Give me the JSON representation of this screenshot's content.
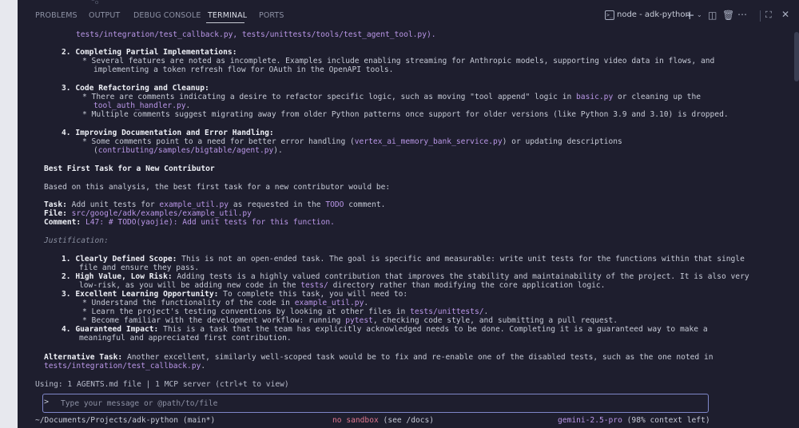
{
  "panel": {
    "tabs": [
      {
        "label": "PROBLEMS"
      },
      {
        "label": "OUTPUT"
      },
      {
        "label": "DEBUG CONSOLE"
      },
      {
        "label": "TERMINAL",
        "active": true
      },
      {
        "label": "PORTS"
      }
    ],
    "terminal_name": "node - adk-python",
    "icons": [
      "terminal-icon",
      "plus-icon",
      "chevron-down-icon",
      "split-icon",
      "trash-icon",
      "more-icon",
      "maximize-icon",
      "close-icon"
    ]
  },
  "output": {
    "l1": "tests/integration/test_callback.py, tests/unittests/tools/test_agent_tool.py).",
    "s2_head": "2. Completing Partial Implementations:",
    "s2_b1a": "* Several features are noted as incomplete. Examples include enabling streaming for Anthropic models, supporting video data in flows, and",
    "s2_b1b": "implementing a token refresh flow for OAuth in the OpenAPI tools.",
    "s3_head": "3. Code Refactoring and Cleanup:",
    "s3_b1a_pre": "* There are comments indicating a desire to refactor specific logic, such as moving \"tool append\" logic in ",
    "s3_b1a_file": "basic.py",
    "s3_b1a_post": " or cleaning up the",
    "s3_b1b_file": "tool_auth_handler.py",
    "s3_b1b_post": ".",
    "s3_b2": "* Multiple comments suggest migrating away from older Python patterns once support for older versions (like Python 3.9 and 3.10) is dropped.",
    "s4_head": "4. Improving Documentation and Error Handling:",
    "s4_b1a_pre": "* Some comments point to a need for better error handling (",
    "s4_b1a_file": "vertex_ai_memory_bank_service.py",
    "s4_b1a_post": ") or updating descriptions",
    "s4_b1b_pre": "(",
    "s4_b1b_file": "contributing/samples/bigtable/agent.py",
    "s4_b1b_post": ").",
    "best_heading": "Best First Task for a New Contributor",
    "based": "Based on this analysis, the best first task for a new contributor would be:",
    "task_label": "Task:",
    "task_pre": " Add unit tests for ",
    "task_file": "example_util.py",
    "task_mid": " as requested in the ",
    "task_todo": "TODO",
    "task_post": " comment.",
    "file_label": "File:",
    "file_path": " src/google/adk/examples/example_util.py",
    "comment_label": "Comment:",
    "comment_text": " L47: # TODO(yaojie): Add unit tests for this function.",
    "justification": "Justification:",
    "j1_label": "1. Clearly Defined Scope:",
    "j1_a": " This is not an open-ended task. The goal is specific and measurable: write unit tests for the functions within that single",
    "j1_b": "file and ensure they pass.",
    "j2_label": "2. High Value, Low Risk:",
    "j2_a": " Adding tests is a highly valued contribution that improves the stability and maintainability of the project. It is also very",
    "j2_b_pre": "low-risk, as you will be adding new code in the ",
    "j2_b_dir": "tests/",
    "j2_b_post": " directory rather than modifying the core application logic.",
    "j3_label": "3. Excellent Learning Opportunity:",
    "j3_a": " To complete this task, you will need to:",
    "j3_b1_pre": "* Understand the functionality of the code in ",
    "j3_b1_file": "example_util.py",
    "j3_b1_post": ".",
    "j3_b2_pre": "* Learn the project's testing conventions by looking at other files in ",
    "j3_b2_dir": "tests/unittests/",
    "j3_b2_post": ".",
    "j3_b3_pre": "* Become familiar with the development workflow: running ",
    "j3_b3_cmd": "pytest",
    "j3_b3_post": ", checking code style, and submitting a pull request.",
    "j4_label": "4. Guaranteed Impact:",
    "j4_a": " This is a task that the team has explicitly acknowledged needs to be done. Completing it is a guaranteed way to make a",
    "j4_b": "meaningful and appreciated first contribution.",
    "alt_label": "Alternative Task:",
    "alt_a": " Another excellent, similarly well-scoped task would be to fix and re-enable one of the disabled tests, such as the one noted in",
    "alt_b_file": "tests/integration/test_callback.py",
    "alt_b_post": ".",
    "using": "Using: 1 AGENTS.md file | 1 MCP server (ctrl+t to view)"
  },
  "input": {
    "prompt": ">",
    "placeholder": "Type your message or @path/to/file"
  },
  "status": {
    "path": "~/Documents/Projects/adk-python",
    "branch": " (main*)",
    "sandbox": "no sandbox",
    "sandbox_hint": " (see /docs)",
    "model": "gemini-2.5-pro",
    "context": " (98% context left)"
  },
  "colors": {
    "background": "#1e1e2e",
    "highlight_purple": "#b996e6",
    "sandbox_pink": "#e0788f",
    "input_border": "#7f87c9"
  }
}
